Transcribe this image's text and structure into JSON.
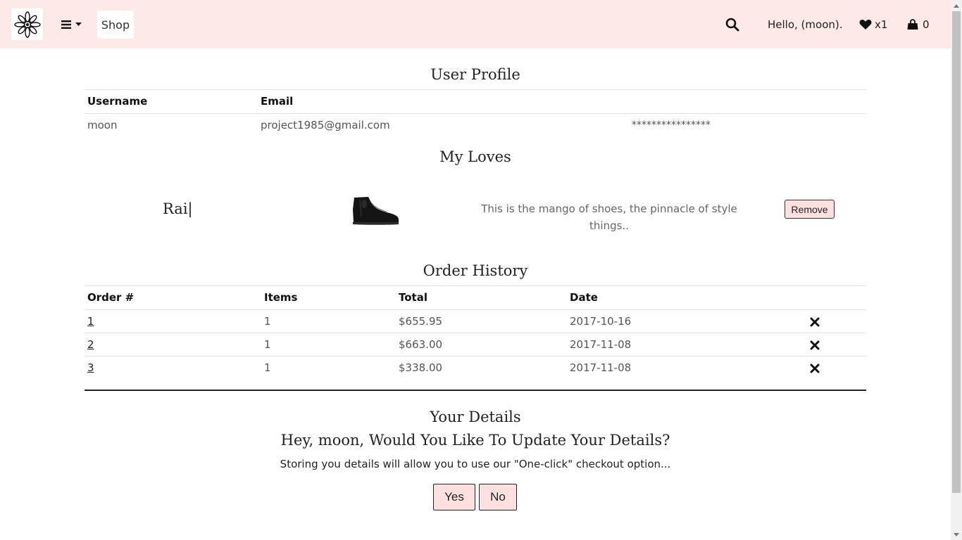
{
  "nav": {
    "logo_icon": "flower-mandala-icon",
    "menu_icon": "hamburger-icon",
    "shop_label": "Shop",
    "search_icon": "search-icon",
    "greeting": "Hello, (moon).",
    "loves_count": "x1",
    "cart_count": "0",
    "background": "#fde9e7"
  },
  "profile": {
    "title": "User Profile",
    "headers": [
      "Username",
      "Email"
    ],
    "row": {
      "username": "moon",
      "email": "project1985@gmail.com",
      "password": "****************"
    }
  },
  "loves": {
    "title": "My Loves",
    "items": [
      {
        "name": "Rai|",
        "image": "black-ankle-boot",
        "description": "This is the mango of shoes, the pinnacle of style things..",
        "remove_label": "Remove"
      }
    ]
  },
  "orders": {
    "title": "Order History",
    "headers": [
      "Order #",
      "Items",
      "Total",
      "Date"
    ],
    "rows": [
      {
        "id": "1",
        "items": "1",
        "total": "$655.95",
        "date": "2017-10-16"
      },
      {
        "id": "2",
        "items": "1",
        "total": "$663.00",
        "date": "2017-11-08"
      },
      {
        "id": "3",
        "items": "1",
        "total": "$338.00",
        "date": "2017-11-08"
      }
    ],
    "delete_icon": "close-icon"
  },
  "details": {
    "title": "Your Details",
    "question": "Hey, moon, Would You Like To Update Your Details?",
    "note": "Storing you details will allow you to use our \"One-click\" checkout option...",
    "yes_label": "Yes",
    "no_label": "No",
    "button_color": "#fde0df"
  }
}
